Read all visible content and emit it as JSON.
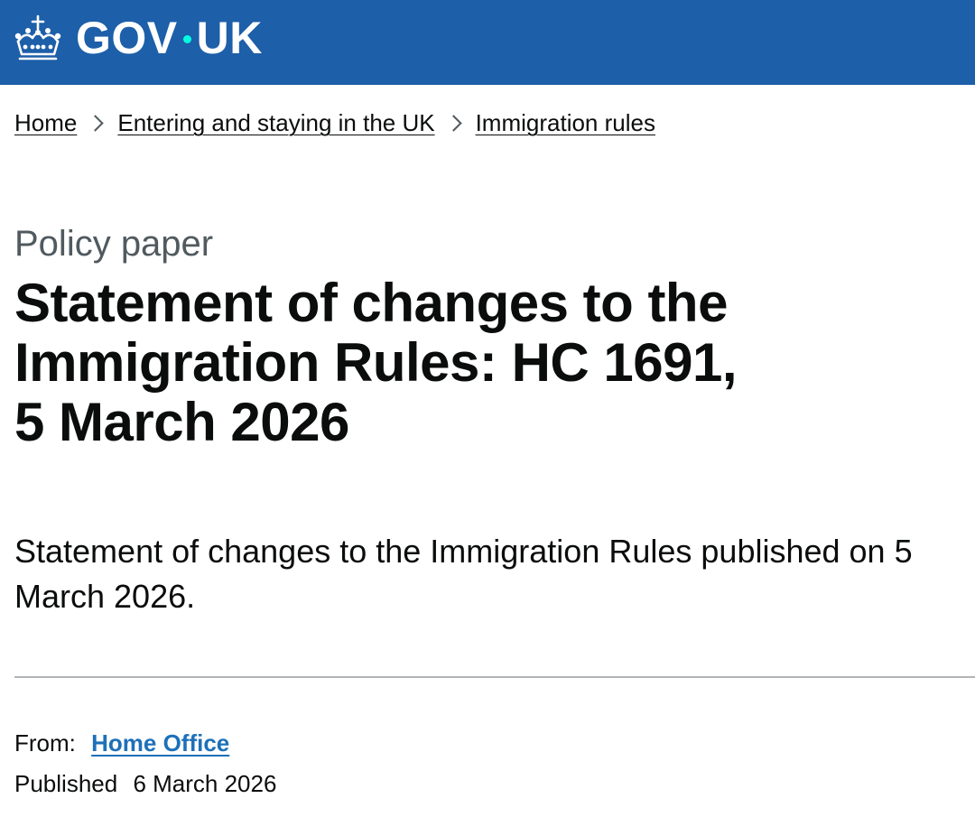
{
  "header": {
    "logo_text_left": "GOV",
    "logo_text_right": "UK",
    "logo_icon": "crown-icon",
    "background_color": "#1d5fa8",
    "dot_color": "#00ffe0"
  },
  "breadcrumb": [
    {
      "label": "Home"
    },
    {
      "label": "Entering and staying in the UK"
    },
    {
      "label": "Immigration rules"
    }
  ],
  "page": {
    "caption": "Policy paper",
    "title": "Statement of changes to the Immigration Rules: HC 1691, 5 March 2026",
    "lead": "Statement of changes to the Immigration Rules published on 5 March 2026."
  },
  "metadata": {
    "from_label": "From:",
    "from_value": "Home Office",
    "published_label": "Published",
    "published_value": "6 March 2026",
    "link_color": "#1d70b8"
  }
}
